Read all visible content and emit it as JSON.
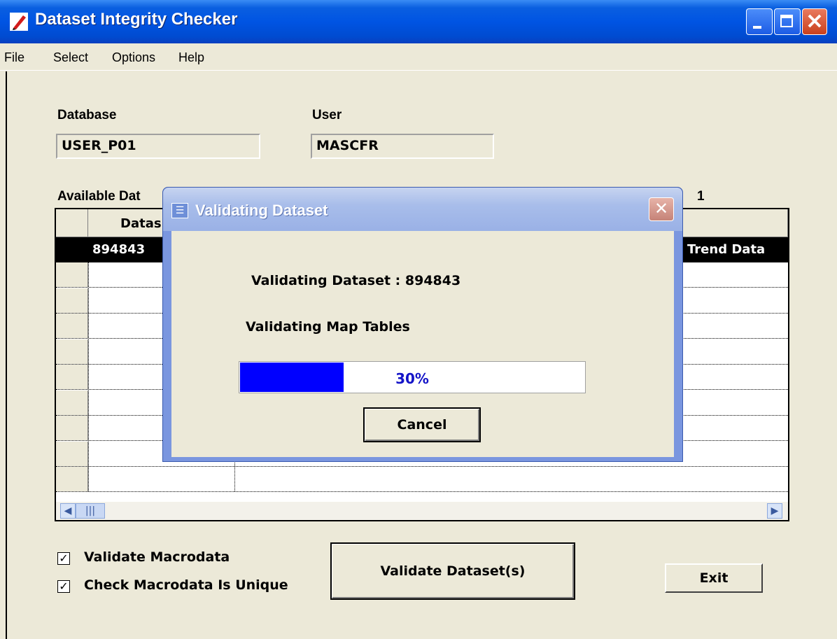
{
  "window": {
    "title": "Dataset Integrity Checker"
  },
  "menu": [
    "File",
    "Select",
    "Options",
    "Help"
  ],
  "database": {
    "label": "Database",
    "value": "USER_P01"
  },
  "user": {
    "label": "User",
    "value": "MASCFR"
  },
  "datasets": {
    "label": "Available Dat",
    "count": "1",
    "column_header": "Datas",
    "rows": [
      {
        "id": "894843",
        "trailing": "Trend Data"
      }
    ]
  },
  "options": {
    "validate_macrodata": {
      "label": "Validate Macrodata",
      "checked": true
    },
    "check_unique": {
      "label": "Check Macrodata Is Unique",
      "checked": true
    }
  },
  "buttons": {
    "validate": "Validate Dataset(s)",
    "exit": "Exit"
  },
  "dialog": {
    "title": "Validating Dataset",
    "line1": "Validating Dataset : 894843",
    "line2": "Validating Map Tables",
    "progress_percent": 30,
    "progress_text": "30%",
    "cancel": "Cancel"
  },
  "colors": {
    "titlebar": "#0054E3",
    "progress_fill": "#0000FF",
    "progress_text": "#1414C8",
    "dialog_frame": "#7A96DF"
  }
}
